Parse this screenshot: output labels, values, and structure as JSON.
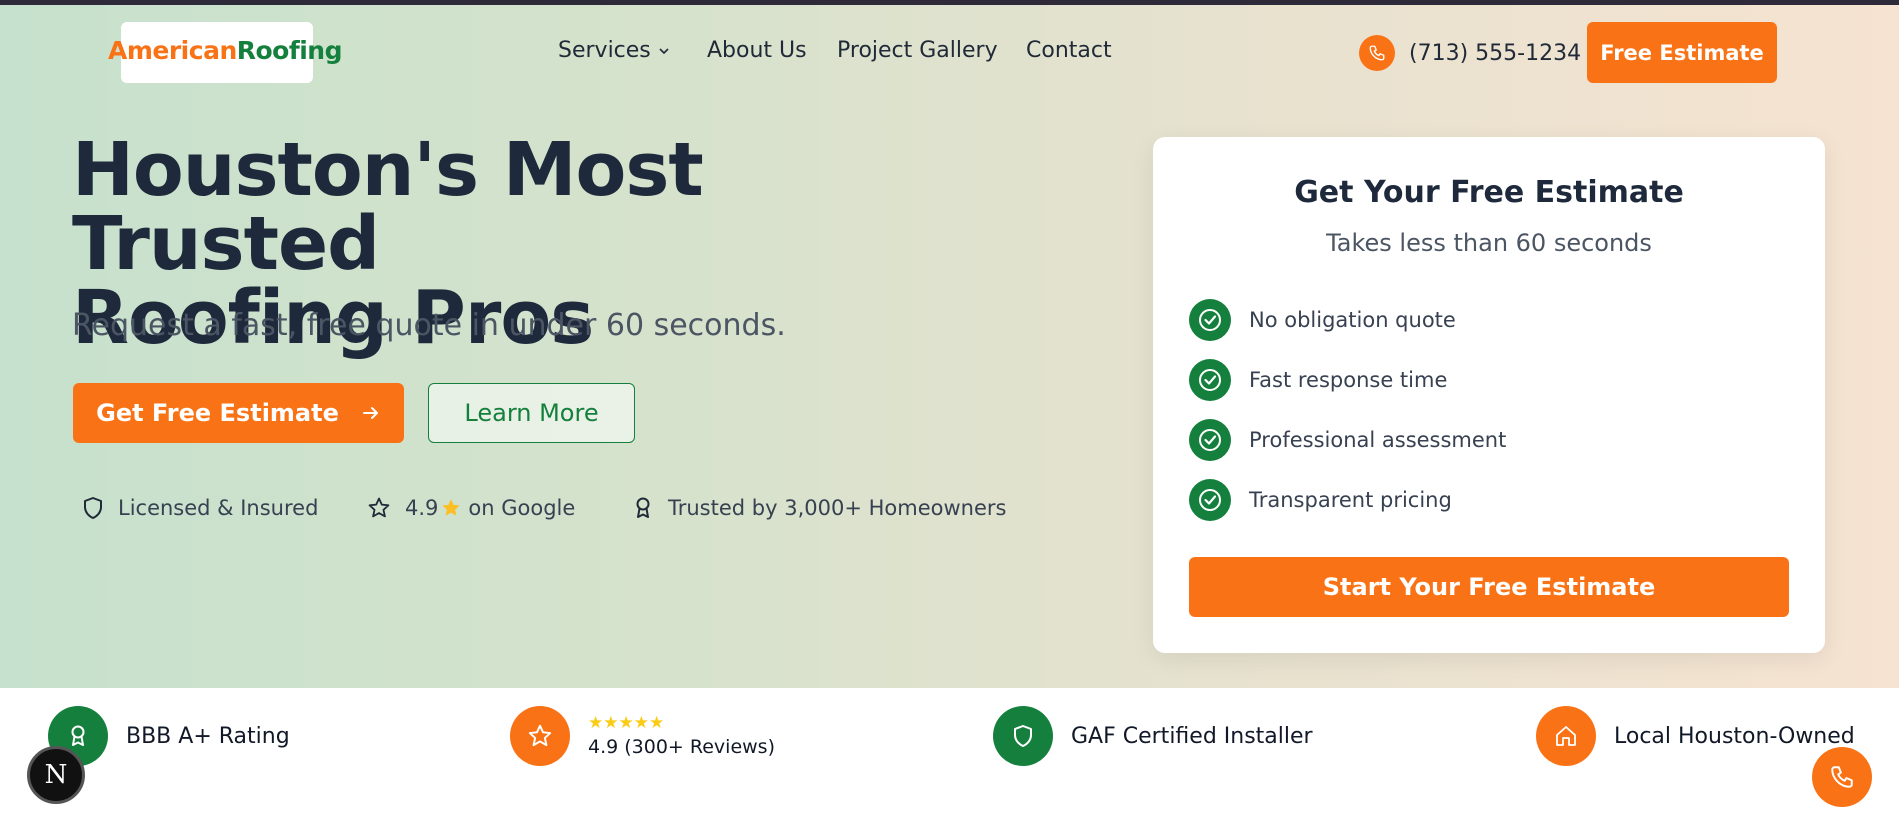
{
  "brand": {
    "part1": "American",
    "part2": "Roofing",
    "color_primary": "#f97316",
    "color_secondary": "#15803d"
  },
  "nav": {
    "services": "Services",
    "about": "About Us",
    "gallery": "Project Gallery",
    "contact": "Contact"
  },
  "header": {
    "phone": "(713) 555-1234",
    "cta": "Free Estimate",
    "phone_icon": "phone-icon"
  },
  "hero": {
    "headline_line1": "Houston's Most Trusted",
    "headline_line2": "Roofing Pros",
    "subhead": "Request a fast, free quote in under 60 seconds.",
    "primary_cta": "Get Free Estimate",
    "secondary_cta": "Learn More",
    "trust": {
      "licensed": "Licensed & Insured",
      "rating_value": "4.9",
      "rating_suffix": "on Google",
      "trusted": "Trusted by 3,000+ Homeowners"
    }
  },
  "estimate_card": {
    "title": "Get Your Free Estimate",
    "subtitle": "Takes less than 60 seconds",
    "benefits": [
      "No obligation quote",
      "Fast response time",
      "Professional assessment",
      "Transparent pricing"
    ],
    "cta": "Start Your Free Estimate"
  },
  "badges": {
    "bbb": "BBB A+ Rating",
    "stars": "★★★★★",
    "reviews": "4.9 (300+ Reviews)",
    "gaf": "GAF Certified Installer",
    "local": "Local Houston-Owned"
  },
  "dev_badge": "N"
}
